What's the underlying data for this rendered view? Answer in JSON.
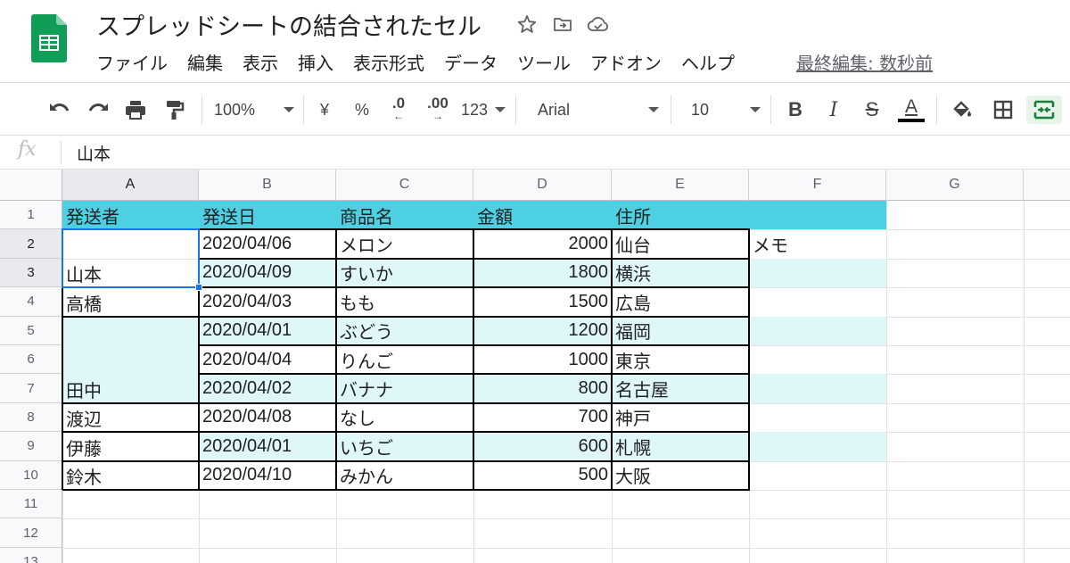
{
  "app": {
    "title": "スプレッドシートの結合されたセル",
    "last_edit": "最終編集: 数秒前"
  },
  "menu": [
    "ファイル",
    "編集",
    "表示",
    "挿入",
    "表示形式",
    "データ",
    "ツール",
    "アドオン",
    "ヘルプ"
  ],
  "toolbar": {
    "zoom": "100%",
    "currency": "¥",
    "percent": "%",
    "dec_decrease": ".0",
    "dec_increase": ".00",
    "format_more": "123",
    "font": "Arial",
    "font_size": "10",
    "bold": "B",
    "italic": "I",
    "strike": "S",
    "text_color": "A"
  },
  "formula": {
    "fx": "fx",
    "value": "山本"
  },
  "grid": {
    "columns": [
      "A",
      "B",
      "C",
      "D",
      "E",
      "F",
      "G"
    ],
    "rows": [
      "1",
      "2",
      "3",
      "4",
      "5",
      "6",
      "7",
      "8",
      "9",
      "10",
      "11",
      "12",
      "13"
    ],
    "header_row": [
      "発送者",
      "発送日",
      "商品名",
      "金額",
      "住所",
      ""
    ],
    "data": [
      {
        "date": "2020/04/06",
        "item": "メロン",
        "amount": "2000",
        "address": "仙台",
        "memo": "メモ"
      },
      {
        "date": "2020/04/09",
        "item": "すいか",
        "amount": "1800",
        "address": "横浜",
        "memo": ""
      },
      {
        "date": "2020/04/03",
        "item": "もも",
        "amount": "1500",
        "address": "広島",
        "memo": ""
      },
      {
        "date": "2020/04/01",
        "item": "ぶどう",
        "amount": "1200",
        "address": "福岡",
        "memo": ""
      },
      {
        "date": "2020/04/04",
        "item": "りんご",
        "amount": "1000",
        "address": "東京",
        "memo": ""
      },
      {
        "date": "2020/04/02",
        "item": "バナナ",
        "amount": "800",
        "address": "名古屋",
        "memo": ""
      },
      {
        "date": "2020/04/08",
        "item": "なし",
        "amount": "700",
        "address": "神戸",
        "memo": ""
      },
      {
        "date": "2020/04/01",
        "item": "いちご",
        "amount": "600",
        "address": "札幌",
        "memo": ""
      },
      {
        "date": "2020/04/10",
        "item": "みかん",
        "amount": "500",
        "address": "大阪",
        "memo": ""
      }
    ],
    "senders": [
      {
        "name": "山本",
        "rows": [
          2,
          3
        ]
      },
      {
        "name": "高橋",
        "rows": [
          4
        ]
      },
      {
        "name": "田中",
        "rows": [
          5,
          6,
          7
        ]
      },
      {
        "name": "渡辺",
        "rows": [
          8
        ]
      },
      {
        "name": "伊藤",
        "rows": [
          9
        ]
      },
      {
        "name": "鈴木",
        "rows": [
          10
        ]
      }
    ],
    "selected_cell": "A2:A3"
  },
  "colors": {
    "header_fill": "#4dd0e1",
    "band_fill": "#e0f7fa",
    "selection": "#1a73e8",
    "logo_green": "#0f9d58"
  }
}
